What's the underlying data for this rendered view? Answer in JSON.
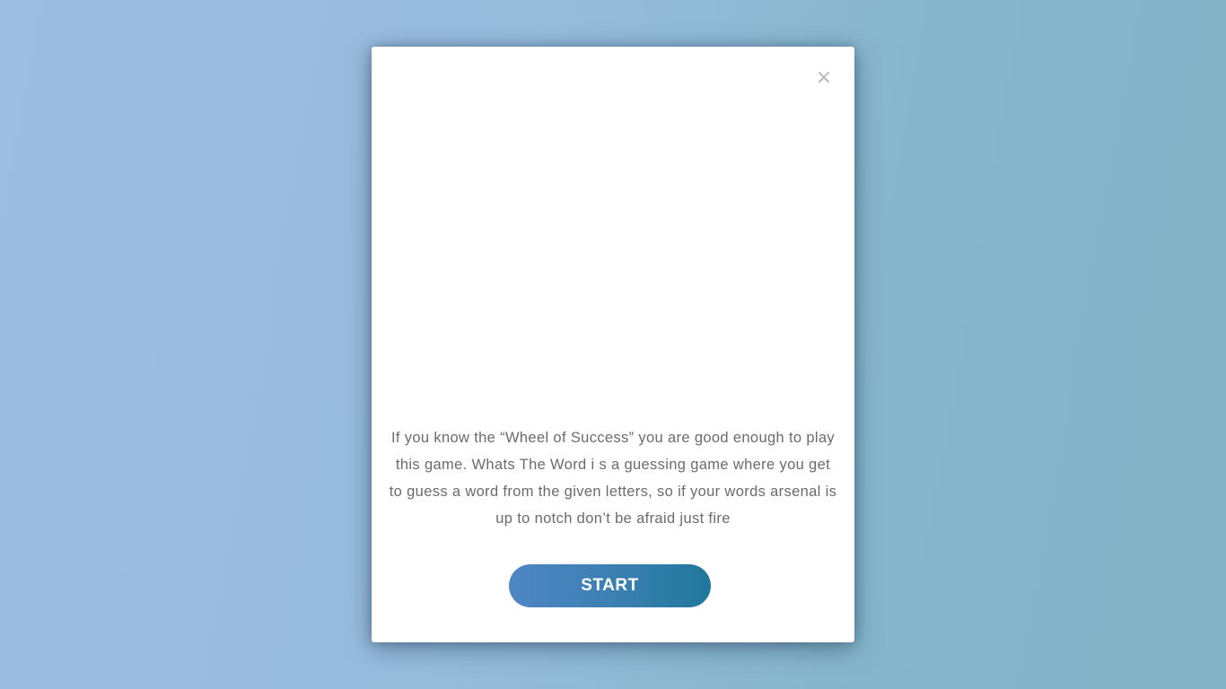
{
  "modal": {
    "close_label": "×",
    "description": "If you know the “Wheel of Success” you are good enough to play this game. Whats The Word i s a guessing game where you get to guess a word from the given letters, so if your words arsenal is up to notch don’t be afraid just fire",
    "start_label": "START"
  },
  "colors": {
    "background_left": "#9dbde2",
    "background_right": "#82b3c7",
    "button_left": "#4f86c4",
    "button_right": "#1f789b",
    "text": "#6b6b6b"
  }
}
